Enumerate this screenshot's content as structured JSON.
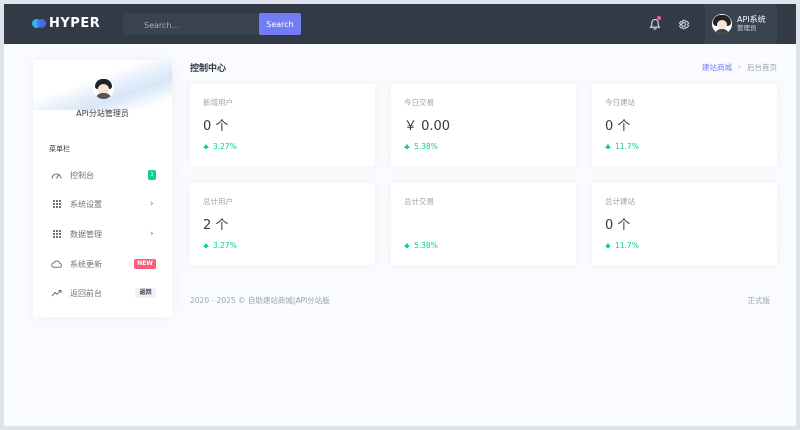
{
  "brand": {
    "name": "HYPER"
  },
  "search": {
    "placeholder": "Search...",
    "button_label": "Search"
  },
  "account": {
    "name": "API系统",
    "role": "管理员"
  },
  "sidebar": {
    "user_name": "API分站管理员",
    "menu_heading": "菜单栏",
    "items": [
      {
        "label": "控制台",
        "icon": "dashboard-icon",
        "badge": "1"
      },
      {
        "label": "系统设置",
        "icon": "grid-icon",
        "chevron": "›"
      },
      {
        "label": "数据管理",
        "icon": "grid-icon",
        "chevron": "›"
      },
      {
        "label": "系统更新",
        "icon": "cloud-icon",
        "badge": "NEW"
      },
      {
        "label": "返回前台",
        "icon": "return-icon",
        "badge": "返回"
      }
    ]
  },
  "page": {
    "title": "控制中心"
  },
  "breadcrumb": {
    "link": "建站商城",
    "separator": "›",
    "current": "后台首页"
  },
  "stats": [
    {
      "title": "新增用户",
      "value": "0 个",
      "trend": "3.27%"
    },
    {
      "title": "今日交易",
      "value": "￥ 0.00",
      "trend": "5.38%"
    },
    {
      "title": "今日建站",
      "value": "0 个",
      "trend": "11.7%"
    },
    {
      "title": "总计用户",
      "value": "2 个",
      "trend": "3.27%"
    },
    {
      "title": "总计交易",
      "value": "",
      "trend": "5.38%"
    },
    {
      "title": "总计建站",
      "value": "0 个",
      "trend": "11.7%"
    }
  ],
  "footer": {
    "copyright": "2020 - 2025 © 自助建站商城|API分站版",
    "edition": "正式版"
  },
  "colors": {
    "topbar": "#313a46",
    "accent": "#727cf5",
    "success": "#0acf97",
    "danger": "#fa5c7c"
  }
}
